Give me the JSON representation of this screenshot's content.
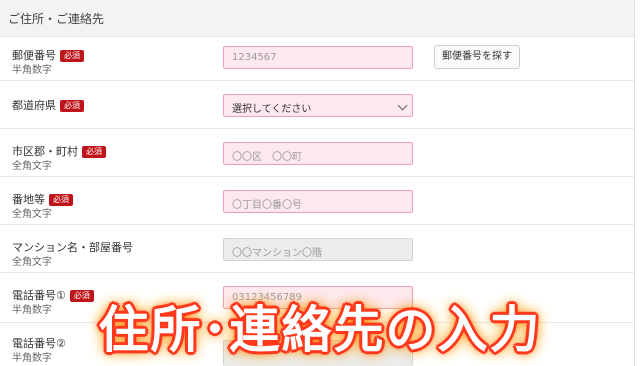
{
  "section": {
    "title": "ご住所・ご連絡先"
  },
  "required_badge": "必須",
  "fields": {
    "postal": {
      "label": "郵便番号",
      "sub": "半角数字",
      "placeholder": "1234567",
      "button": "郵便番号を探す"
    },
    "prefecture": {
      "label": "都道府県",
      "select_value": "選択してください"
    },
    "city": {
      "label": "市区郡・町村",
      "sub": "全角文字",
      "placeholder": "〇〇区　〇〇町"
    },
    "address": {
      "label": "番地等",
      "sub": "全角文字",
      "placeholder": "〇丁目〇番〇号"
    },
    "building": {
      "label": "マンション名・部屋番号",
      "sub": "全角文字",
      "placeholder": "〇〇マンション〇階"
    },
    "phone1": {
      "label": "電話番号①",
      "sub": "半角数字",
      "placeholder": "03123456789"
    },
    "phone2": {
      "label": "電話番号②",
      "sub": "半角数字"
    }
  },
  "overlay_text": "住所･連絡先の入力",
  "colors": {
    "required": "#c0141b",
    "input_bg": "#fde8ee",
    "input_border": "#f0a0b0",
    "overlay_glow": "#ff3a1e"
  }
}
